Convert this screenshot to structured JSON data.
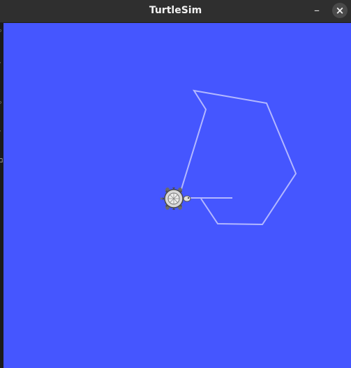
{
  "window": {
    "title": "TurtleSim",
    "minimize_glyph": "–",
    "close_glyph": "×"
  },
  "colors": {
    "background": "#4556ff",
    "path": "#b3b8ff",
    "titlebar": "#2f2f2f"
  },
  "turtle": {
    "icon": "turtle-icon",
    "heading": "east"
  }
}
